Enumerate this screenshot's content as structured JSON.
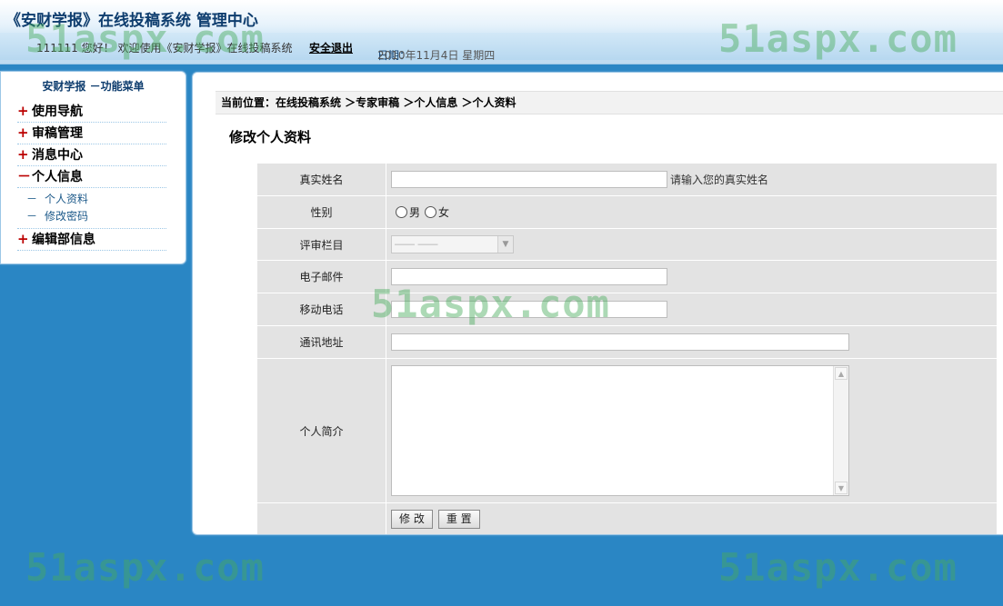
{
  "header": {
    "title": "《安财学报》在线投稿系统 管理中心",
    "welcome": "111111 您好！ 欢迎使用《安财学报》在线投稿系统",
    "logout": "安全退出",
    "date_label": "日期：",
    "date_value": "2010年11月4日 星期四"
  },
  "watermark": "51aspx.com",
  "sidebar": {
    "title": "安财学报 －功能菜单",
    "items": [
      {
        "symbol": "+",
        "label": "使用导航"
      },
      {
        "symbol": "+",
        "label": "审稿管理"
      },
      {
        "symbol": "+",
        "label": "消息中心"
      },
      {
        "symbol": "－",
        "label": "个人信息"
      },
      {
        "symbol": "+",
        "label": "编辑部信息"
      }
    ],
    "subitems": [
      {
        "dash": "－",
        "label": "个人资料"
      },
      {
        "dash": "－",
        "label": "修改密码"
      }
    ]
  },
  "breadcrumb": "当前位置：在线投稿系统 ＞专家审稿 ＞个人信息 ＞个人资料",
  "page_title": "修改个人资料",
  "form": {
    "real_name_label": "真实姓名",
    "real_name_value": "",
    "real_name_hint": "请输入您的真实姓名",
    "gender_label": "性别",
    "gender_male": "男",
    "gender_female": "女",
    "column_label": "评审栏目",
    "column_value": "―― ――",
    "email_label": "电子邮件",
    "email_value": "",
    "mobile_label": "移动电话",
    "mobile_value": "",
    "address_label": "通讯地址",
    "address_value": "",
    "bio_label": "个人简介",
    "bio_value": "",
    "submit_label": "修 改",
    "reset_label": "重 置"
  },
  "colors": {
    "background": "#2a86c4",
    "header_text": "#0e3d6e",
    "menu_symbol": "#bb0000",
    "watermark": "#46aa5a"
  }
}
